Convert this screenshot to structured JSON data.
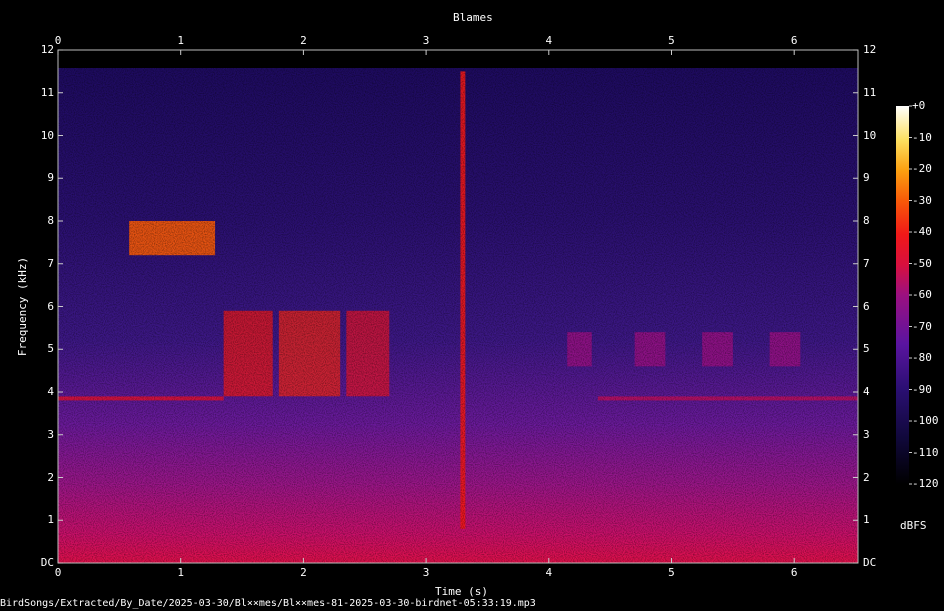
{
  "chart_data": {
    "type": "heatmap",
    "title": "Blames",
    "xlabel": "Time (s)",
    "ylabel": "Frequency (kHz)",
    "xlim": [
      0,
      6.52
    ],
    "ylim": [
      0,
      12
    ],
    "x_ticks": [
      "0",
      "1",
      "2",
      "3",
      "4",
      "5",
      "6"
    ],
    "x_tick_values": [
      0,
      1,
      2,
      3,
      4,
      5,
      6
    ],
    "y_ticks": [
      "DC",
      "1",
      "2",
      "3",
      "4",
      "5",
      "6",
      "7",
      "8",
      "9",
      "10",
      "11",
      "12"
    ],
    "y_tick_values": [
      0,
      1,
      2,
      3,
      4,
      5,
      6,
      7,
      8,
      9,
      10,
      11,
      12
    ],
    "colorbar": {
      "label": "dBFS",
      "ticks": [
        "+0",
        "-10",
        "-20",
        "-30",
        "-40",
        "-50",
        "-60",
        "-70",
        "-80",
        "-90",
        "-100",
        "-110",
        "-120"
      ],
      "tick_values": [
        0,
        -10,
        -20,
        -30,
        -40,
        -50,
        -60,
        -70,
        -80,
        -90,
        -100,
        -110,
        -120
      ],
      "range": [
        -120,
        0
      ]
    },
    "features": [
      {
        "name": "tone-3.85kHz",
        "t": [
          0,
          1.35
        ],
        "f": 3.85,
        "db": -48
      },
      {
        "name": "tone-3.85kHz-late",
        "t": [
          4.4,
          6.52
        ],
        "f": 3.85,
        "db": -55
      },
      {
        "name": "chirp-7.9-7.4kHz",
        "t": [
          0.58,
          1.28
        ],
        "f": 7.6,
        "db": -30
      },
      {
        "name": "burst-5kHz-a",
        "t": [
          1.35,
          1.75
        ],
        "f": 4.9,
        "db": -40
      },
      {
        "name": "burst-5kHz-b",
        "t": [
          1.8,
          2.3
        ],
        "f": 4.9,
        "db": -38
      },
      {
        "name": "burst-5kHz-c",
        "t": [
          2.35,
          2.7
        ],
        "f": 4.9,
        "db": -45
      },
      {
        "name": "click",
        "t": [
          3.28,
          3.32
        ],
        "f": 6.0,
        "db": -40
      },
      {
        "name": "note-5kHz",
        "t": [
          4.15,
          4.35
        ],
        "f": 5.0,
        "db": -62
      },
      {
        "name": "note-5kHz",
        "t": [
          4.7,
          4.95
        ],
        "f": 5.0,
        "db": -62
      },
      {
        "name": "note-5kHz",
        "t": [
          5.25,
          5.5
        ],
        "f": 5.0,
        "db": -62
      },
      {
        "name": "note-5kHz",
        "t": [
          5.8,
          6.05
        ],
        "f": 5.0,
        "db": -62
      }
    ]
  },
  "file_path": "BirdSongs/Extracted/By_Date/2025-03-30/Bl××mes/Bl××mes-81-2025-03-30-birdnet-05:33:19.mp3"
}
